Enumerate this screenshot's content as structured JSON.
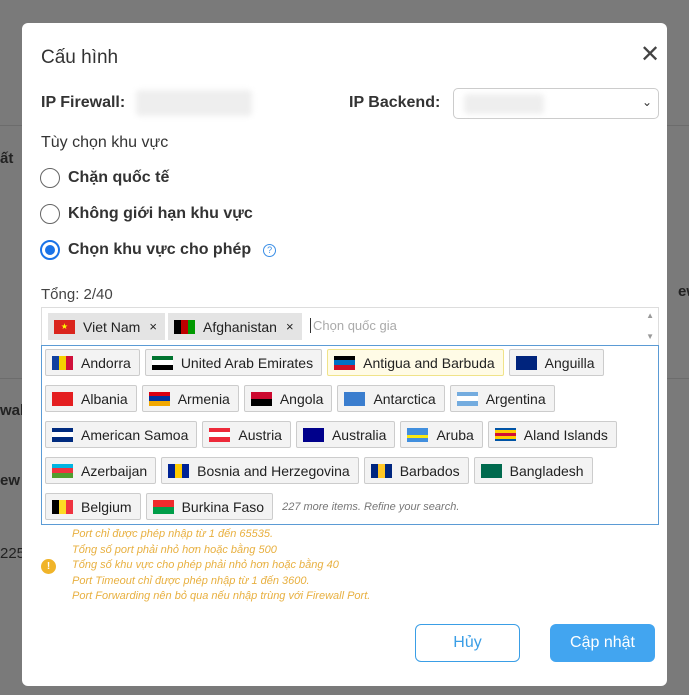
{
  "background": {
    "fragments": [
      "ất",
      "ew",
      "wall",
      "ew",
      "225"
    ]
  },
  "modal": {
    "title": "Cấu hình",
    "ip_firewall_label": "IP Firewall:",
    "ip_backend_label": "IP Backend:",
    "region_section": "Tùy chọn khu vực",
    "radios": [
      {
        "label": "Chặn quốc tế",
        "checked": false
      },
      {
        "label": "Không giới hạn khu vực",
        "checked": false
      },
      {
        "label": "Chọn khu vực cho phép",
        "checked": true
      }
    ],
    "total": "Tổng: 2/40",
    "selected": [
      {
        "label": "Viet Nam",
        "flag": [
          "#da251d"
        ]
      },
      {
        "label": "Afghanistan",
        "flag": [
          "#000000",
          "#be0000",
          "#009900"
        ]
      }
    ],
    "placeholder": "Chọn quốc gia",
    "options": [
      [
        {
          "label": "Andorra",
          "flag": [
            "#1040a0",
            "#f5d000",
            "#d0103a"
          ],
          "dir": "v"
        },
        {
          "label": "United Arab Emirates",
          "flag": [
            "#00732f",
            "#ffffff",
            "#000000"
          ],
          "dir": "h"
        },
        {
          "label": "Antigua and Barbuda",
          "flag": [
            "#000000",
            "#0072c6",
            "#ce1126"
          ],
          "dir": "h",
          "highlighted": true
        },
        {
          "label": "Anguilla",
          "flag": [
            "#00247d"
          ],
          "dir": "h"
        }
      ],
      [
        {
          "label": "Albania",
          "flag": [
            "#e41e20"
          ],
          "dir": "h"
        },
        {
          "label": "Armenia",
          "flag": [
            "#d90012",
            "#0033a0",
            "#f2a800"
          ],
          "dir": "h"
        },
        {
          "label": "Angola",
          "flag": [
            "#cc092f",
            "#000000"
          ],
          "dir": "h"
        },
        {
          "label": "Antarctica",
          "flag": [
            "#3a7dce"
          ],
          "dir": "h"
        },
        {
          "label": "Argentina",
          "flag": [
            "#74acdf",
            "#ffffff",
            "#74acdf"
          ],
          "dir": "h"
        }
      ],
      [
        {
          "label": "American Samoa",
          "flag": [
            "#002b7f",
            "#ffffff",
            "#002b7f"
          ],
          "dir": "h"
        },
        {
          "label": "Austria",
          "flag": [
            "#ed2939",
            "#ffffff",
            "#ed2939"
          ],
          "dir": "h"
        },
        {
          "label": "Australia",
          "flag": [
            "#00008b"
          ],
          "dir": "h"
        },
        {
          "label": "Aruba",
          "flag": [
            "#418fde",
            "#418fde",
            "#f9e814",
            "#418fde"
          ],
          "dir": "h"
        },
        {
          "label": "Aland Islands",
          "flag": [
            "#0053a5",
            "#ffce00",
            "#d21034",
            "#ffce00",
            "#0053a5"
          ],
          "dir": "h"
        }
      ],
      [
        {
          "label": "Azerbaijan",
          "flag": [
            "#00b5e2",
            "#ef3340",
            "#509e2f"
          ],
          "dir": "h"
        },
        {
          "label": "Bosnia and Herzegovina",
          "flag": [
            "#002395",
            "#fecb00",
            "#002395"
          ],
          "dir": "v"
        },
        {
          "label": "Barbados",
          "flag": [
            "#00267f",
            "#ffc726",
            "#00267f"
          ],
          "dir": "v"
        },
        {
          "label": "Bangladesh",
          "flag": [
            "#006a4e"
          ],
          "dir": "h"
        }
      ],
      [
        {
          "label": "Belgium",
          "flag": [
            "#000000",
            "#fdda24",
            "#ef3340"
          ],
          "dir": "v"
        },
        {
          "label": "Burkina Faso",
          "flag": [
            "#ef2b2d",
            "#009e49"
          ],
          "dir": "h"
        }
      ]
    ],
    "more_text": "227 more items. Refine your search.",
    "messages": [
      "Port chỉ được phép nhập từ 1 đến 65535.",
      "Tổng số port phải nhỏ hơn hoặc bằng 500",
      "Tổng số khu vực cho phép phải nhỏ hơn hoặc bằng 40",
      "Port Timeout chỉ được phép nhập từ 1 đến 3600.",
      "Port Forwarding nên bỏ qua nếu nhập trùng với Firewall Port."
    ],
    "cancel_label": "Hủy",
    "update_label": "Cập nhật"
  }
}
